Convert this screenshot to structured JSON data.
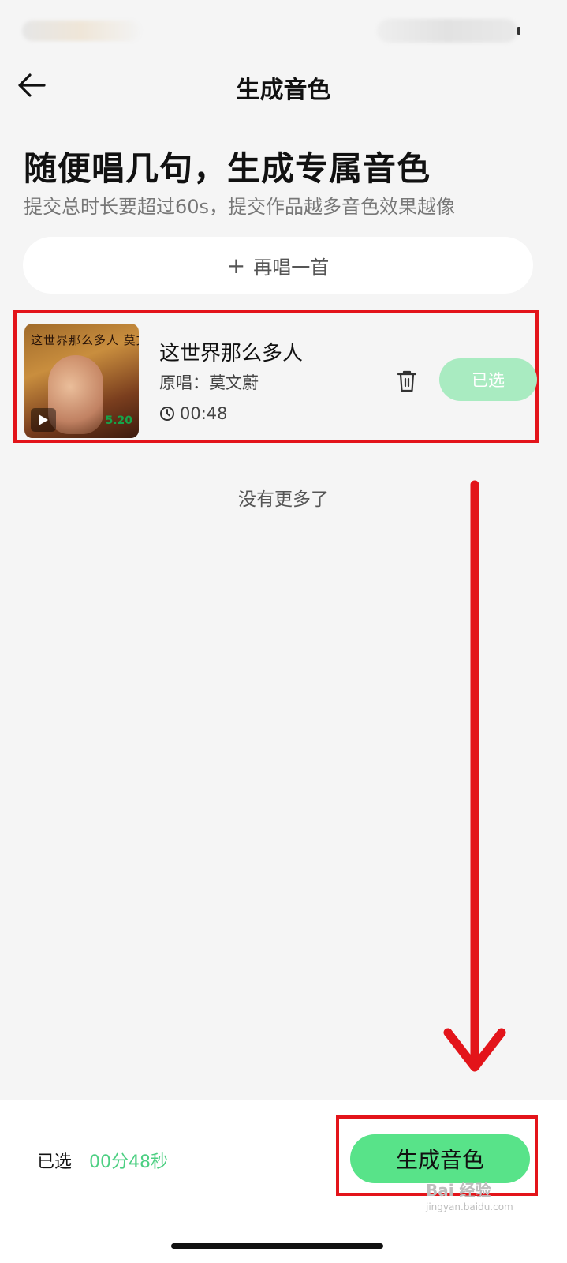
{
  "nav": {
    "title": "生成音色"
  },
  "header": {
    "heading": "随便唱几句，生成专属音色",
    "subheading": "提交总时长要超过60s，提交作品越多音色效果越像"
  },
  "actions": {
    "sing_again_label": "再唱一首",
    "plus_icon": "+"
  },
  "song": {
    "title": "这世界那么多人",
    "artist_line": "原唱：莫文蔚",
    "duration": "00:48",
    "selected_label": "已选",
    "cover_text": "这世界那么多人 莫文蔚",
    "cover_date": "5.20"
  },
  "list": {
    "end_text": "没有更多了"
  },
  "footer": {
    "selected_label": "已选",
    "selected_value": "00分48秒",
    "generate_label": "生成音色"
  },
  "watermark": {
    "line1": "Bai 经验",
    "line2": "jingyan.baidu.com"
  },
  "colors": {
    "accent_green": "#58e389",
    "light_green": "#a9ebc1",
    "value_green": "#4ccf82",
    "annotation_red": "#e3141a",
    "background": "#f5f5f5"
  },
  "icons": [
    "back-arrow-icon",
    "plus-icon",
    "play-icon",
    "clock-icon",
    "trash-icon",
    "down-arrow-annotation-icon"
  ]
}
